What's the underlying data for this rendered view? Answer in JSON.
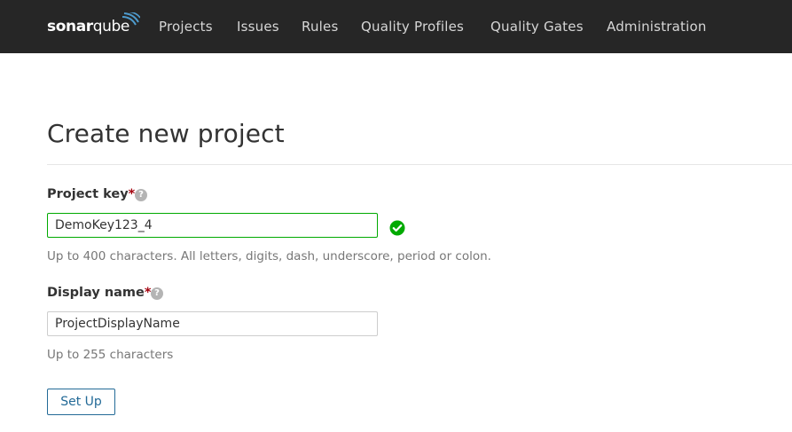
{
  "header": {
    "logo_text": "sonarqube",
    "nav": [
      {
        "label": "Projects"
      },
      {
        "label": "Issues"
      },
      {
        "label": "Rules"
      },
      {
        "label": "Quality Profiles"
      },
      {
        "label": "Quality Gates"
      },
      {
        "label": "Administration"
      }
    ]
  },
  "page": {
    "title": "Create new project"
  },
  "form": {
    "project_key": {
      "label": "Project key",
      "required_mark": "*",
      "value": "DemoKey123_4",
      "hint": "Up to 400 characters. All letters, digits, dash, underscore, period or colon.",
      "status": "valid"
    },
    "display_name": {
      "label": "Display name",
      "required_mark": "*",
      "value": "ProjectDisplayName",
      "hint": "Up to 255 characters"
    },
    "submit_label": "Set Up"
  },
  "icons": {
    "help": "help-icon",
    "valid": "check-circle-icon"
  },
  "colors": {
    "topbar": "#262626",
    "nav_text": "#d6d6d6",
    "required": "#a4030f",
    "valid": "#00aa00",
    "button": "#236a97",
    "hint": "#777777"
  }
}
